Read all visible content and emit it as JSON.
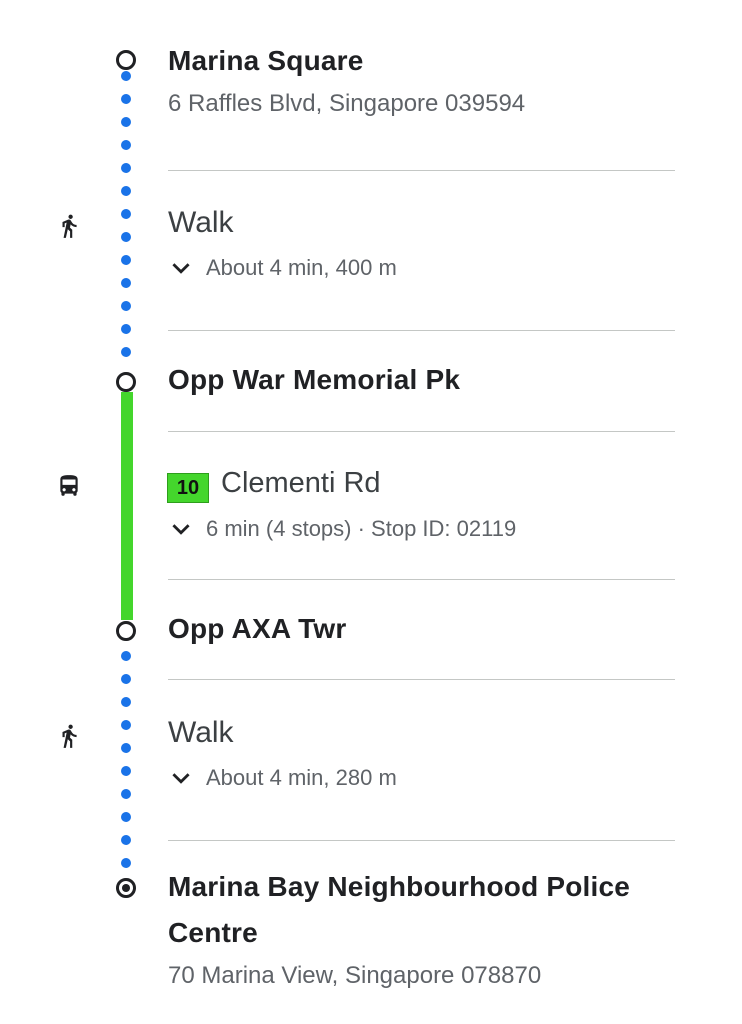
{
  "origin": {
    "name": "Marina Square",
    "address": "6 Raffles Blvd, Singapore 039594"
  },
  "segments": [
    {
      "mode": "walk",
      "icon": "walk-icon",
      "title": "Walk",
      "detail": "About 4 min, 400 m"
    },
    {
      "stop": "Opp War Memorial Pk"
    },
    {
      "mode": "bus",
      "icon": "bus-icon",
      "route_number": "10",
      "route_name": "Clementi Rd",
      "route_color": "#44d62c",
      "detail": "6 min (4 stops) · Stop ID: 02119"
    },
    {
      "stop": "Opp AXA Twr"
    },
    {
      "mode": "walk",
      "icon": "walk-icon",
      "title": "Walk",
      "detail": "About 4 min, 280 m"
    }
  ],
  "destination": {
    "name_line1": "Marina Bay Neighbourhood Police",
    "name_line2": "Centre",
    "address": "70 Marina View, Singapore 078870"
  },
  "colors": {
    "walk_dots": "#1a73e8",
    "bus_line": "#44d62c",
    "divider": "#c4c7c5"
  }
}
